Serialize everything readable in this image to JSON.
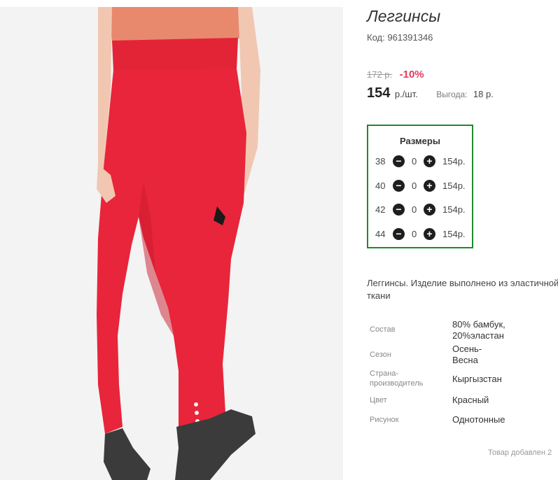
{
  "product": {
    "title": "Леггинсы",
    "code_label": "Код:",
    "code_value": "961391346",
    "image_alt": "red leggings product photo"
  },
  "pricing": {
    "old_price": "172 р.",
    "discount": "-10%",
    "price_value": "154",
    "price_unit": "р./шт.",
    "benefit_label": "Выгода:",
    "benefit_value": "18 р."
  },
  "sizes": {
    "title": "Размеры",
    "rows": [
      {
        "size": "38",
        "qty": "0",
        "price": "154р."
      },
      {
        "size": "40",
        "qty": "0",
        "price": "154р."
      },
      {
        "size": "42",
        "qty": "0",
        "price": "154р."
      },
      {
        "size": "44",
        "qty": "0",
        "price": "154р."
      }
    ],
    "minus_icon": "minus-circle-icon",
    "plus_icon": "plus-circle-icon"
  },
  "description": "Леггинсы. Изделие выполнено из эластичной ткани",
  "attributes": [
    {
      "label": "Состав",
      "value": "80% бамбук, 20%эластан"
    },
    {
      "label": "Сезон",
      "value": "Осень-Весна"
    },
    {
      "label": "Страна-производитель",
      "value": "Кыргызстан"
    },
    {
      "label": "Цвет",
      "value": "Красный"
    },
    {
      "label": "Рисунок",
      "value": "Однотонные"
    }
  ],
  "footer_note": "Товар добавлен 2",
  "colors": {
    "size_box_border": "#1f8a2a",
    "discount": "#e33a5a",
    "product": "#e8253a"
  }
}
